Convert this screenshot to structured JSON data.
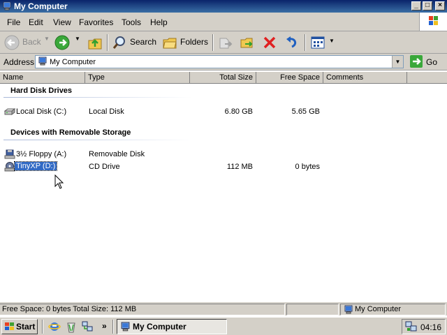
{
  "window": {
    "title": "My Computer",
    "minimize": "_",
    "maximize": "□",
    "close": "×"
  },
  "menu": {
    "items": [
      "File",
      "Edit",
      "View",
      "Favorites",
      "Tools",
      "Help"
    ]
  },
  "toolbar": {
    "back_label": "Back",
    "search_label": "Search",
    "folders_label": "Folders"
  },
  "address": {
    "label": "Address",
    "value": "My Computer",
    "go_label": "Go"
  },
  "columns": [
    "Name",
    "Type",
    "Total Size",
    "Free Space",
    "Comments"
  ],
  "groups": [
    {
      "title": "Hard Disk Drives",
      "items": [
        {
          "name": "Local Disk (C:)",
          "type": "Local Disk",
          "total": "6.80 GB",
          "free": "5.65 GB",
          "icon": "hard-disk-icon"
        }
      ]
    },
    {
      "title": "Devices with Removable Storage",
      "items": [
        {
          "name": "3½ Floppy (A:)",
          "type": "Removable Disk",
          "total": "",
          "free": "",
          "icon": "floppy-drive-icon"
        },
        {
          "name": "TinyXP (D:)",
          "type": "CD Drive",
          "total": "112 MB",
          "free": "0 bytes",
          "icon": "cd-drive-icon",
          "selected": true
        }
      ]
    }
  ],
  "status": {
    "left": "Free Space: 0 bytes Total Size: 112 MB",
    "middle": "",
    "right": "My Computer"
  },
  "taskbar": {
    "start_label": "Start",
    "chevron": "»",
    "task_label": "My Computer",
    "clock": "04:16"
  },
  "colors": {
    "titlebar": "#0a246a",
    "selection": "#316ac5",
    "chrome": "#d4d0c8"
  }
}
